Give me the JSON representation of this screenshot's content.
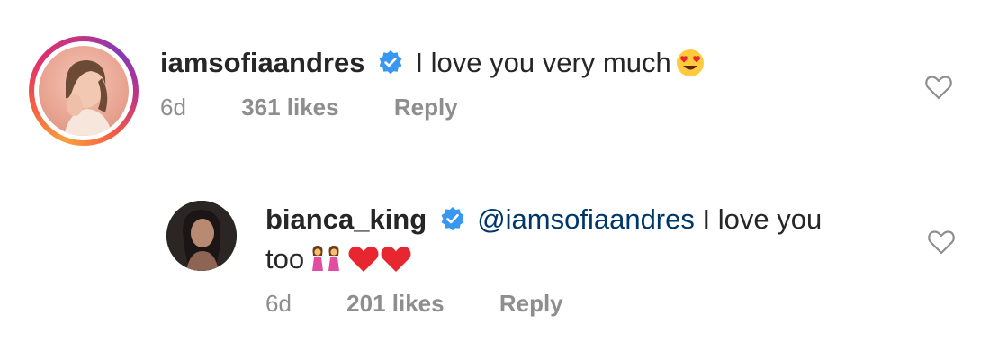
{
  "comments": [
    {
      "username": "iamsofiaandres",
      "verified": true,
      "text": "I love you very much",
      "emoji": "heart-eyes-emoji",
      "age": "6d",
      "likes": "361 likes",
      "reply_label": "Reply"
    },
    {
      "username": "bianca_king",
      "verified": true,
      "mention": "@iamsofiaandres",
      "text_line1": "I love you",
      "text_line2": "too",
      "emoji": [
        "two-women-emoji",
        "red-heart-emoji",
        "red-heart-emoji"
      ],
      "age": "6d",
      "likes": "201 likes",
      "reply_label": "Reply"
    }
  ],
  "colors": {
    "verified_blue": "#3897f0",
    "mention_blue": "#00376b",
    "meta_gray": "#8e8e8e",
    "text": "#262626"
  }
}
